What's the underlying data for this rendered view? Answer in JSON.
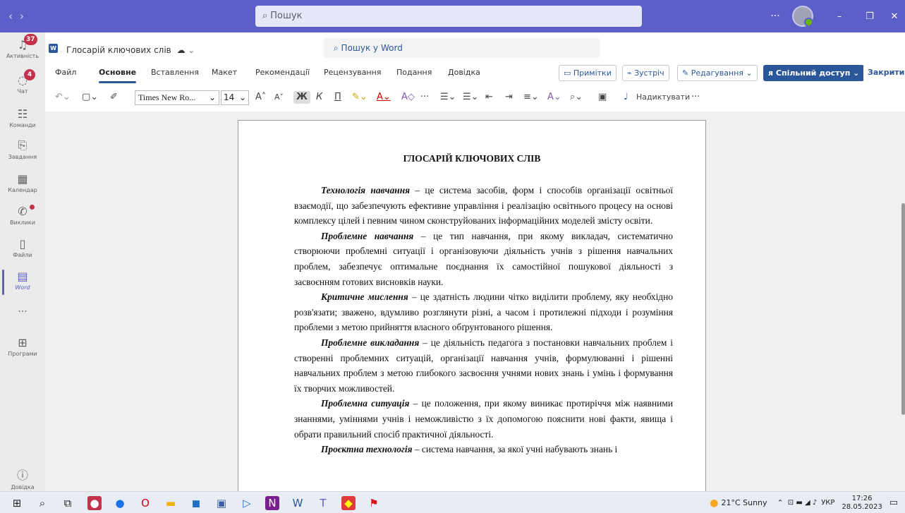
{
  "titlebar": {
    "search_placeholder": "Пошук",
    "more": "···",
    "minimize": "–",
    "maximize": "❐",
    "close": "✕"
  },
  "sidebar": {
    "items": [
      {
        "label": "Активність",
        "badge": "37"
      },
      {
        "label": "Чат",
        "badge": "4"
      },
      {
        "label": "Команди"
      },
      {
        "label": "Завдання"
      },
      {
        "label": "Календар"
      },
      {
        "label": "Виклики"
      },
      {
        "label": "Файли"
      },
      {
        "label": "Word"
      },
      {
        "label": "···"
      },
      {
        "label": "Програми"
      },
      {
        "label": "Довідка"
      }
    ]
  },
  "document": {
    "name": "Глосарій ключових слів",
    "search_placeholder": "Пошук у Word"
  },
  "ribbon": {
    "tabs": [
      "Файл",
      "Основне",
      "Вставлення",
      "Макет",
      "Рекомендації",
      "Рецензування",
      "Подання",
      "Довідка"
    ],
    "comments": "Примітки",
    "meeting": "Зустріч",
    "editing": "Редагування",
    "share": "Спільний доступ",
    "close": "Закрити",
    "font": "Times New Ro...",
    "size": "14",
    "bold": "Ж",
    "italic": "К",
    "dictate": "Надиктувати"
  },
  "page": {
    "title": "ГЛОСАРІЙ КЛЮЧОВИХ СЛІВ",
    "paragraphs": [
      {
        "term": "Технологія навчання",
        "text": " – це система засобів, форм і способів організації освітньої взаємодії, що забезпечують ефективне управління і реалізацію освітнього процесу на основі комплексу цілей і певним чином сконструйованих інформаційних моделей змісту освіти."
      },
      {
        "term": "Проблемне навчання",
        "text": " – це тип навчання, при якому викладач, систематично створюючи проблемні ситуації і організовуючи діяльність учнів з рішення навчальних проблем, забезпечує оптимальне поєднання їх самостійної пошукової діяльності з засвоєнням готових висновків науки."
      },
      {
        "term": "Критичне мислення",
        "text": " – це здатність людини чітко виділити проблему, яку необхідно розв'язати; зважено, вдумливо розглянути різні, а часом і протилежні підходи і розуміння проблеми з метою прийняття власного обґрунтованого рішення."
      },
      {
        "term": "Проблемне викладання",
        "text": " – це діяльність педагога з постановки навчальних проблем і створенні проблемних ситуацій, організації навчання учнів, формулюванні і рішенні навчальних проблем з метою глибокого засвоєння учнями нових знань і умінь і формування їх творчих можливостей."
      },
      {
        "term": "Проблемна ситуація",
        "text": " – це положення, при якому виникає протиріччя між наявними знаннями, уміннями учнів і неможливістю з їх допомогою пояснити нові факти, явища і обрати правильний спосіб практичної діяльності."
      },
      {
        "term": "Проєктна технологія",
        "text": " – система навчання, за якої учні набувають знань і"
      }
    ]
  },
  "taskbar": {
    "weather": "21°C Sunny",
    "language": "УКР",
    "time": "17:26",
    "date": "28.05.2023"
  }
}
